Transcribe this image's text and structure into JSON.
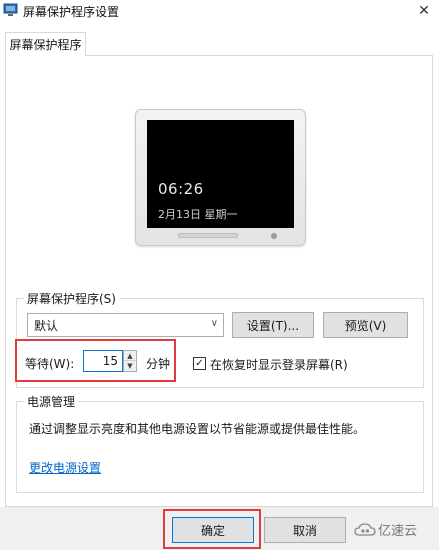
{
  "window": {
    "title": "屏幕保护程序设置",
    "close_glyph": "✕"
  },
  "tabs": [
    {
      "label": "屏幕保护程序"
    }
  ],
  "preview": {
    "time": "06:26",
    "date": "2月13日  星期一"
  },
  "screensaver_group": {
    "legend": "屏幕保护程序(S)",
    "selected": "默认",
    "settings_button": "设置(T)...",
    "preview_button": "预览(V)",
    "wait_label": "等待(W):",
    "wait_value": "15",
    "minutes_label": "分钟",
    "resume_checkbox_label": "在恢复时显示登录屏幕(R)",
    "resume_checked": true
  },
  "power_group": {
    "legend": "电源管理",
    "description": "通过调整显示亮度和其他电源设置以节省能源或提供最佳性能。",
    "link": "更改电源设置"
  },
  "footer": {
    "ok_button": "确定",
    "cancel_button": "取消"
  },
  "watermark": {
    "text": "亿速云"
  },
  "colors": {
    "highlight": "#e23b3b",
    "link": "#0066cc",
    "accent": "#0078d7"
  }
}
